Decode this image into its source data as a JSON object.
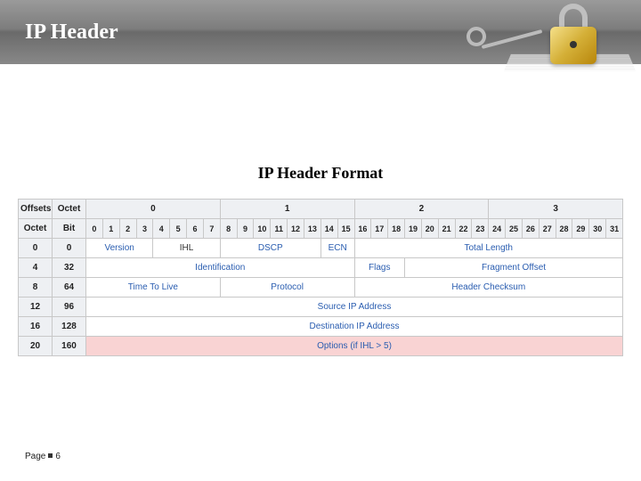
{
  "header": {
    "title": "IP Header"
  },
  "subtitle": "IP Header Format",
  "footer": {
    "page_label": "Page",
    "page_number": "6"
  },
  "table": {
    "corner_offsets": "Offsets",
    "corner_octet": "Octet",
    "octet_headers": [
      "0",
      "1",
      "2",
      "3"
    ],
    "row2_left1": "Octet",
    "row2_left2": "Bit",
    "bits": [
      "0",
      "1",
      "2",
      "3",
      "4",
      "5",
      "6",
      "7",
      "8",
      "9",
      "10",
      "11",
      "12",
      "13",
      "14",
      "15",
      "16",
      "17",
      "18",
      "19",
      "20",
      "21",
      "22",
      "23",
      "24",
      "25",
      "26",
      "27",
      "28",
      "29",
      "30",
      "31"
    ],
    "rows": [
      {
        "octet": "0",
        "bit": "0",
        "cells": [
          {
            "text": "Version",
            "span": 4,
            "cls": "link"
          },
          {
            "text": "IHL",
            "span": 4,
            "cls": ""
          },
          {
            "text": "DSCP",
            "span": 6,
            "cls": "link"
          },
          {
            "text": "ECN",
            "span": 2,
            "cls": "link"
          },
          {
            "text": "Total Length",
            "span": 16,
            "cls": "link"
          }
        ]
      },
      {
        "octet": "4",
        "bit": "32",
        "cells": [
          {
            "text": "Identification",
            "span": 16,
            "cls": "link"
          },
          {
            "text": "Flags",
            "span": 3,
            "cls": "link"
          },
          {
            "text": "Fragment Offset",
            "span": 13,
            "cls": "link"
          }
        ]
      },
      {
        "octet": "8",
        "bit": "64",
        "cells": [
          {
            "text": "Time To Live",
            "span": 8,
            "cls": "link"
          },
          {
            "text": "Protocol",
            "span": 8,
            "cls": "link"
          },
          {
            "text": "Header Checksum",
            "span": 16,
            "cls": "link"
          }
        ]
      },
      {
        "octet": "12",
        "bit": "96",
        "cells": [
          {
            "text": "Source IP Address",
            "span": 32,
            "cls": "link"
          }
        ]
      },
      {
        "octet": "16",
        "bit": "128",
        "cells": [
          {
            "text": "Destination IP Address",
            "span": 32,
            "cls": "link"
          }
        ]
      },
      {
        "octet": "20",
        "bit": "160",
        "cells": [
          {
            "text": "Options (if IHL > 5)",
            "span": 32,
            "cls": "opt"
          }
        ]
      }
    ]
  }
}
